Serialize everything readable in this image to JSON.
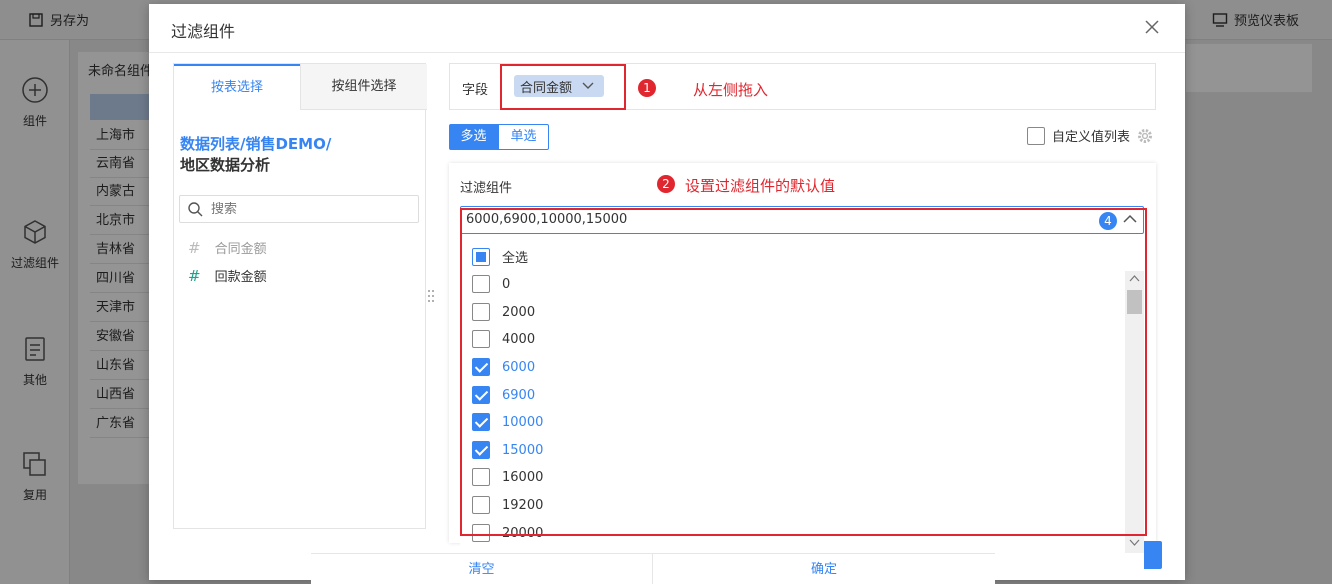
{
  "app": {
    "toolbar": {
      "save_as_label": "另存为",
      "preview_label": "预览仪表板"
    },
    "sidebar": {
      "items": [
        {
          "label": "组件",
          "icon": "plus-circle-icon"
        },
        {
          "label": "过滤组件",
          "icon": "cube-icon"
        },
        {
          "label": "其他",
          "icon": "document-icon"
        },
        {
          "label": "复用",
          "icon": "copy-icon"
        }
      ]
    },
    "canvas": {
      "widget_title": "未命名组件",
      "rows": [
        "上海市",
        "云南省",
        "内蒙古",
        "北京市",
        "吉林省",
        "四川省",
        "天津市",
        "安徽省",
        "山东省",
        "山西省",
        "广东省"
      ]
    }
  },
  "dialog": {
    "title": "过滤组件",
    "left": {
      "tabs": [
        {
          "label": "按表选择",
          "active": true
        },
        {
          "label": "按组件选择",
          "active": false
        }
      ],
      "path_link": "数据列表/销售DEMO/",
      "path_rest": "地区数据分析",
      "search_placeholder": "搜索",
      "fields": [
        {
          "label": "合同金额",
          "enabled": false
        },
        {
          "label": "回款金额",
          "enabled": true
        }
      ]
    },
    "right": {
      "field_label": "字段",
      "field_chip": "合同金额",
      "annotation_1": {
        "badge": "1",
        "text": "从左侧拖入"
      },
      "annotation_2": {
        "badge": "2",
        "text": "设置过滤组件的默认值"
      },
      "mode": {
        "multi": "多选",
        "single": "单选",
        "active": "multi"
      },
      "custom_list_label": "自定义值列表",
      "filter_label": "过滤组件",
      "selected_value": "6000,6900,10000,15000",
      "selected_count": "4",
      "dropdown": {
        "select_all": "全选",
        "items": [
          {
            "value": "0",
            "checked": false
          },
          {
            "value": "2000",
            "checked": false
          },
          {
            "value": "4000",
            "checked": false
          },
          {
            "value": "6000",
            "checked": true
          },
          {
            "value": "6900",
            "checked": true
          },
          {
            "value": "10000",
            "checked": true
          },
          {
            "value": "15000",
            "checked": true
          },
          {
            "value": "16000",
            "checked": false
          },
          {
            "value": "19200",
            "checked": false
          },
          {
            "value": "20000",
            "checked": false
          }
        ],
        "clear_label": "清空",
        "confirm_label": "确定"
      }
    }
  },
  "colors": {
    "accent": "#3685f2",
    "annotation": "#e0262e",
    "teal": "#1aa38a"
  }
}
